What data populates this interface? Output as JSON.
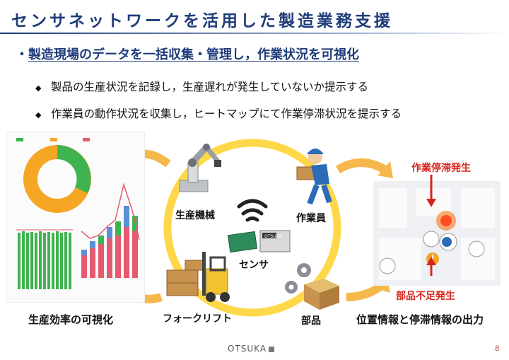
{
  "slide": {
    "title": "センサネットワークを活用した製造業務支援",
    "bullet": "・",
    "headline": "製造現場のデータを一括収集・管理し，作業状況を可視化",
    "points": [
      "製品の生産状況を記録し，生産遅れが発生していないか提示する",
      "作業員の動作状況を収集し，ヒートマップにて作業停滞状況を提示する"
    ],
    "diamond": "◆",
    "labels": {
      "machine": "生産機械",
      "worker": "作業員",
      "sensor": "センサ",
      "forklift": "フォークリフト",
      "parts": "部品",
      "efficiency": "生産効率の可視化",
      "location": "位置情報と停滞情報の出力",
      "stall": "作業停滞発生",
      "shortage": "部品不足発生"
    },
    "sensor_tag": "OTSUKA",
    "footer_logo": "OTSUKA",
    "page_number": "8"
  },
  "colors": {
    "title": "#1f3c7a",
    "circle": "#ffd84a",
    "arrow": "#f6b84a",
    "red": "#d6261c",
    "green": "#3fb34f",
    "orange": "#f5a623",
    "pink": "#e55a6f",
    "blue": "#5b8fd6"
  }
}
